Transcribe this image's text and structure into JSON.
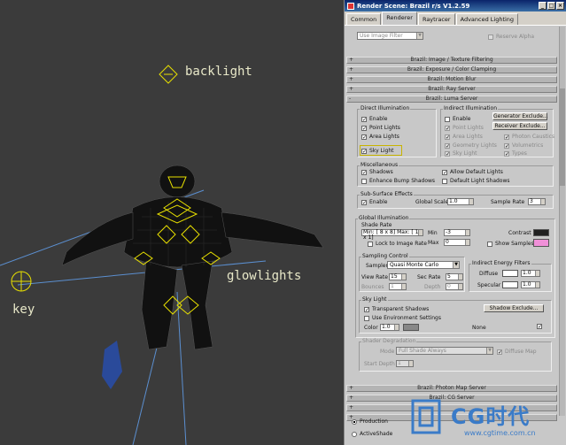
{
  "viewport": {
    "labels": {
      "backlight": "backlight",
      "glowlights": "glowlights",
      "key": "key"
    }
  },
  "dialog": {
    "title": "Render Scene: Brazil r/s V1.2.59",
    "tabs": [
      "Common",
      "Renderer",
      "Raytracer",
      "Advanced Lighting"
    ],
    "active_tab": "Renderer",
    "top_row": {
      "use_image_filter": "Use Image Filter",
      "reserve_alpha": "Reserve Alpha"
    },
    "rollouts": {
      "image_filtering": "Brazil: Image / Texture Filtering",
      "exposure": "Brazil: Exposure / Color Clamping",
      "motion_blur": "Brazil: Motion Blur",
      "ray_server": "Brazil: Ray Server",
      "luma_server": "Brazil: Luma Server",
      "photon_map": "Brazil: Photon Map Server",
      "cg_server": "Brazil: CG Server"
    },
    "direct": {
      "caption": "Direct Illumination",
      "enable": "Enable",
      "point_lights": "Point Lights",
      "area_lights": "Area Lights",
      "sky_light": "Sky Light"
    },
    "indirect": {
      "caption": "Indirect Illumination",
      "enable": "Enable",
      "generator_exclude": "Generator Exclude...",
      "receiver_exclude": "Receiver Exclude...",
      "point_lights": "Point Lights",
      "area_lights": "Area Lights",
      "geometry_lights": "Geometry Lights",
      "sky_light": "Sky Light",
      "photon_caustics": "Photon Caustics",
      "volumetrics": "Volumetrics",
      "types": "Types"
    },
    "misc": {
      "caption": "Miscellaneous",
      "shadows": "Shadows",
      "allow_default_lights": "Allow Default Lights",
      "enhance_bump_shadows": "Enhance Bump Shadows",
      "default_light_shadows": "Default Light Shadows"
    },
    "sss": {
      "caption": "Sub-Surface Effects",
      "enable": "Enable",
      "global_scale_label": "Global Scale",
      "global_scale": "1.0",
      "sample_rate_label": "Sample Rate",
      "sample_rate": "3"
    },
    "gi": {
      "caption": "Global Illumination",
      "shade_rate_caption": "Shade Rate",
      "shade_rate_value": "Min: [ 8 x 8]   Max: [ 1 x 1]",
      "min_label": "Min",
      "min": "-3",
      "max_label": "Max",
      "max": "0",
      "contrast_label": "Contrast",
      "lock_image_rate": "Lock to Image Rate",
      "show_samples": "Show Samples",
      "sampling_caption": "Sampling Control",
      "sampler_label": "Sampler",
      "sampler": "Quasi Monte Carlo",
      "view_rate_label": "View Rate",
      "view_rate": "15",
      "sec_rate_label": "Sec Rate",
      "sec_rate": "5",
      "bounces_label": "Bounces",
      "bounces": "1",
      "depth_label": "Depth",
      "depth": "0",
      "indirect_energy_caption": "Indirect Energy Filters",
      "diffuse_label": "Diffuse",
      "diffuse": "1.0",
      "specular_label": "Specular",
      "specular": "1.0",
      "colors": {
        "contrast": "#202020",
        "show_samples": "#f090d8",
        "diffuse": "#ffffff",
        "specular": "#ffffff",
        "sky_color": "#888888"
      }
    },
    "skylight": {
      "caption": "Sky Light",
      "transparent_shadows": "Transparent Shadows",
      "shadow_exclude": "Shadow Exclude...",
      "use_environment": "Use Environment Settings",
      "color_label": "Color",
      "color_value": "1.0",
      "none_label": "None"
    },
    "shader_degradation": {
      "caption": "Shader Degradation",
      "mode_label": "Mode",
      "mode": "Full Shade Always",
      "diffuse_map": "Diffuse Map",
      "start_depth_label": "Start Depth",
      "start_depth": "1"
    },
    "bottom": {
      "production": "Production",
      "activeshade": "ActiveShade"
    }
  },
  "watermark": {
    "brand": "CG时代",
    "url": "www.cgtime.com.cn"
  }
}
